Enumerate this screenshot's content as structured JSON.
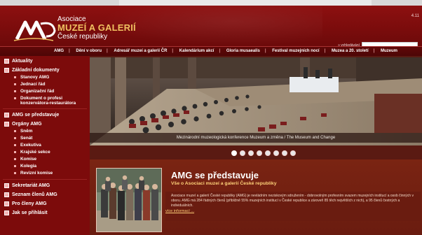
{
  "header": {
    "logo_line1": "Asociace",
    "logo_line2": "MUZEÍ A GALERIÍ",
    "logo_line3": "České republiky",
    "date": "4.11",
    "search_label": "» vyhledávání",
    "search_placeholder": ""
  },
  "nav": {
    "items": [
      {
        "label": "AMG"
      },
      {
        "label": "Dění v oboru"
      },
      {
        "label": "Adresář muzeí a galerií ČR"
      },
      {
        "label": "Kalendárium akcí"
      },
      {
        "label": "Gloria musaealis"
      },
      {
        "label": "Festival muzejních nocí"
      },
      {
        "label": "Muzea a 20. století"
      },
      {
        "label": "Muzeum"
      }
    ]
  },
  "sidebar": {
    "sections": [
      {
        "label": "Aktuality",
        "subs": []
      },
      {
        "label": "Základní dokumenty",
        "subs": [
          "Stanovy AMG",
          "Jednací řád",
          "Organizační řád",
          "Dokument o profesi konzervátora-restaurátora"
        ]
      },
      {
        "label": "AMG se představuje",
        "subs": []
      },
      {
        "label": "Orgány AMG",
        "subs": [
          "Sněm",
          "Senát",
          "Exekutiva",
          "Krajské sekce",
          "Komise",
          "Kolegia",
          "Revizní komise"
        ]
      },
      {
        "label": "Sekretariát AMG",
        "subs": []
      },
      {
        "label": "Seznam členů AMG",
        "subs": []
      },
      {
        "label": "Pro členy AMG",
        "subs": []
      },
      {
        "label": "Jak se přihlásit",
        "subs": []
      }
    ]
  },
  "banner": {
    "caption": "Mezinárodní muzeologická konference Muzeum a změna / The Museum and Change",
    "slides": 8,
    "active_slide": 1
  },
  "content": {
    "title": "AMG se představuje",
    "subtitle": "Vše o Asociaci muzeí a galerií České republiky",
    "body": "Asociace muzeí a galerií České republiky (AMG) je nevládním neziskovým sdružením - dobrovolným profesním svazem muzejních institucí a osob činných v oboru. AMG má 284 řádných členů (přibližně 55% muzejních institucí v České republice a zároveň 85 těch největších z nich), a 95 členů čestných a individuálních.",
    "more_link": "více informací ..."
  },
  "colors": {
    "brand_red": "#8d1010",
    "nav_dark": "#4c0606",
    "accent_gold": "#f0c060",
    "content_bg": "#7a2412"
  }
}
